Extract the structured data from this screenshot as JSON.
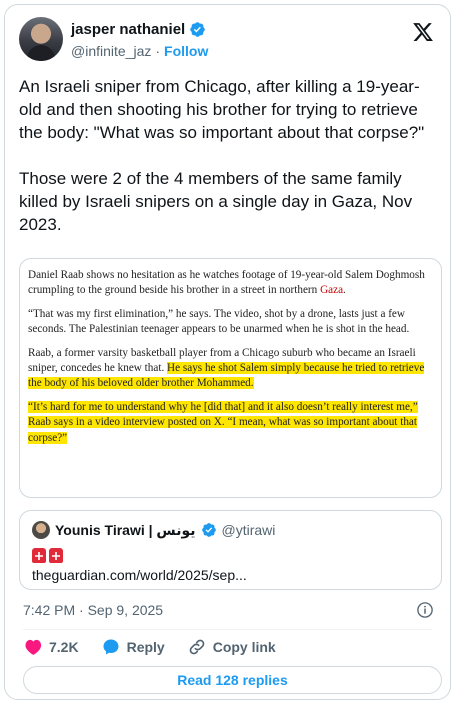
{
  "author": {
    "display_name": "jasper nathaniel",
    "handle": "@infinite_jaz",
    "separator": "·",
    "follow_label": "Follow"
  },
  "tweet": {
    "text": "An Israeli sniper from Chicago, after killing a 19-year-old and then shooting his brother for trying to retrieve the body: \"What was so important about that corpse?\"\n\nThose were 2 of the 4 members of the same family killed by Israeli snipers on a single day in Gaza, Nov 2023.",
    "timestamp": "7:42 PM · Sep 9, 2025"
  },
  "article": {
    "p1_a": "Daniel Raab shows no hesitation as he watches footage of 19-year-old Salem Doghmosh crumpling to the ground beside his brother in a street in northern ",
    "p1_link": "Gaza",
    "p1_b": ".",
    "p2": "“That was my first elimination,” he says. The video, shot by a drone, lasts just a few seconds. The Palestinian teenager appears to be unarmed when he is shot in the head.",
    "p3_a": "Raab, a former varsity basketball player from a Chicago suburb who became an Israeli sniper, concedes he knew that. ",
    "p3_hl": "He says he shot Salem simply because he tried to retrieve the body of his beloved older brother Mohammed.",
    "p4_hl1": "“It’s hard for me to understand why he [did that] and it also doesn’t really interest me,",
    "p4_mid": "” Raab says in a video interview posted on X. ",
    "p4_hl2": "“I mean, what was so important about that corpse?”"
  },
  "quote": {
    "display_name": "Younis Tirawi | يونس",
    "handle": "@ytirawi",
    "emoji": [
      "police-car-light",
      "police-car-light"
    ],
    "link_text": "theguardian.com/world/2025/sep..."
  },
  "actions": {
    "like_count": "7.2K",
    "reply_label": "Reply",
    "copy_label": "Copy link"
  },
  "read_replies_label": "Read 128 replies",
  "colors": {
    "accent": "#1d9bf0",
    "like": "#f91880",
    "highlight": "#ffe600",
    "link_red": "#c70000"
  }
}
